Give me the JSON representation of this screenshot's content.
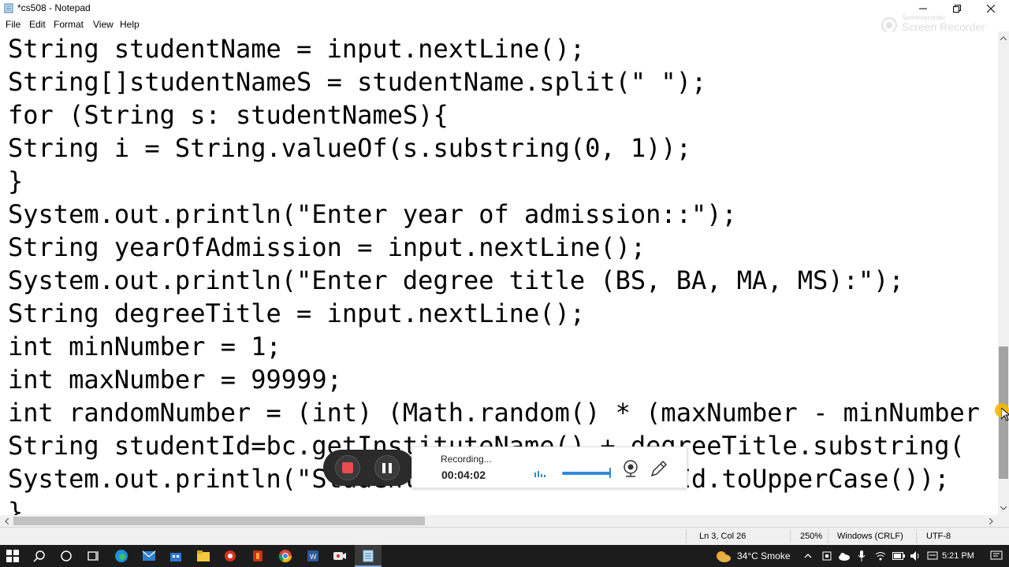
{
  "window": {
    "title": "*cs508 - Notepad",
    "minimize_icon": "minimize-icon",
    "maximize_icon": "restore-icon",
    "close_icon": "close-icon"
  },
  "menu": {
    "items": [
      "File",
      "Edit",
      "Format",
      "View",
      "Help"
    ]
  },
  "watermark": {
    "small": "Screenrecorder",
    "big": "Screen Recorder"
  },
  "editor": {
    "lines": [
      "String studentName = input.nextLine();",
      "String[]studentNameS = studentName.split(\" \");",
      "for (String s: studentNameS){",
      "String i = String.valueOf(s.substring(0, 1));",
      "}",
      "System.out.println(\"Enter year of admission::\");",
      "String yearOfAdmission = input.nextLine();",
      "System.out.println(\"Enter degree title (BS, BA, MA, MS):\");",
      "String degreeTitle = input.nextLine();",
      "int minNumber = 1;",
      "int maxNumber = 99999;",
      "int randomNumber = (int) (Math.random() * (maxNumber - minNumber",
      "String studentId=bc.getInstituteName() + degreeTitle.substring(",
      "System.out.println(\"Student ID : \" + studentId.toUpperCase());",
      "}"
    ]
  },
  "status": {
    "position": "Ln 3, Col 26",
    "zoom": "250%",
    "line_ending": "Windows (CRLF)",
    "encoding": "UTF-8"
  },
  "recorder": {
    "status": "Recording...",
    "elapsed": "00:04:02",
    "stop_color": "#e84c4c",
    "slider_color": "#2e8bd8"
  },
  "taskbar": {
    "weather": "34°C  Smoke",
    "time": "5:21 PM",
    "icons": [
      "windows-start-icon",
      "search-icon",
      "cortana-icon",
      "task-view-icon",
      "edge-icon",
      "mail-icon",
      "store-icon",
      "file-explorer-icon",
      "app-red-icon",
      "app-orange-icon",
      "chrome-icon",
      "word-icon",
      "screen-recorder-icon",
      "notepad-icon"
    ]
  }
}
